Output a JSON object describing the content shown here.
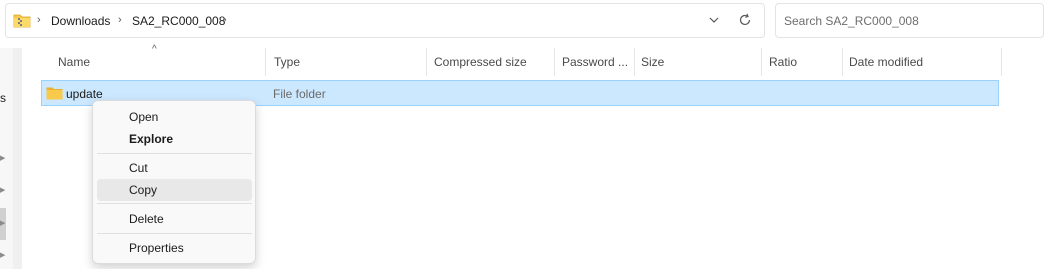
{
  "address": {
    "breadcrumbs": [
      "Downloads",
      "SA2_RC000_008"
    ],
    "folder_icon": "zip-folder-icon",
    "dropdown_icon": "chevron-down-icon",
    "refresh_icon": "refresh-icon"
  },
  "search": {
    "placeholder": "Search SA2_RC000_008"
  },
  "nav": {
    "cut_text": "s",
    "arrow_icon": "chevron-right-icon"
  },
  "columns": [
    {
      "label": "Name"
    },
    {
      "label": "Type"
    },
    {
      "label": "Compressed size"
    },
    {
      "label": "Password ..."
    },
    {
      "label": "Size"
    },
    {
      "label": "Ratio"
    },
    {
      "label": "Date modified"
    }
  ],
  "sort_indicator": "^",
  "rows": [
    {
      "name": "update",
      "type": "File folder",
      "icon": "folder-icon",
      "selected": true
    }
  ],
  "context_menu": {
    "items": [
      {
        "label": "Open"
      },
      {
        "label": "Explore"
      },
      {
        "label": "Cut"
      },
      {
        "label": "Copy"
      },
      {
        "label": "Delete"
      },
      {
        "label": "Properties"
      }
    ],
    "hovered": "Copy"
  },
  "colors": {
    "selection_bg": "#cce8ff",
    "selection_border": "#99d1ff",
    "folder_yellow": "#f8c94a"
  }
}
